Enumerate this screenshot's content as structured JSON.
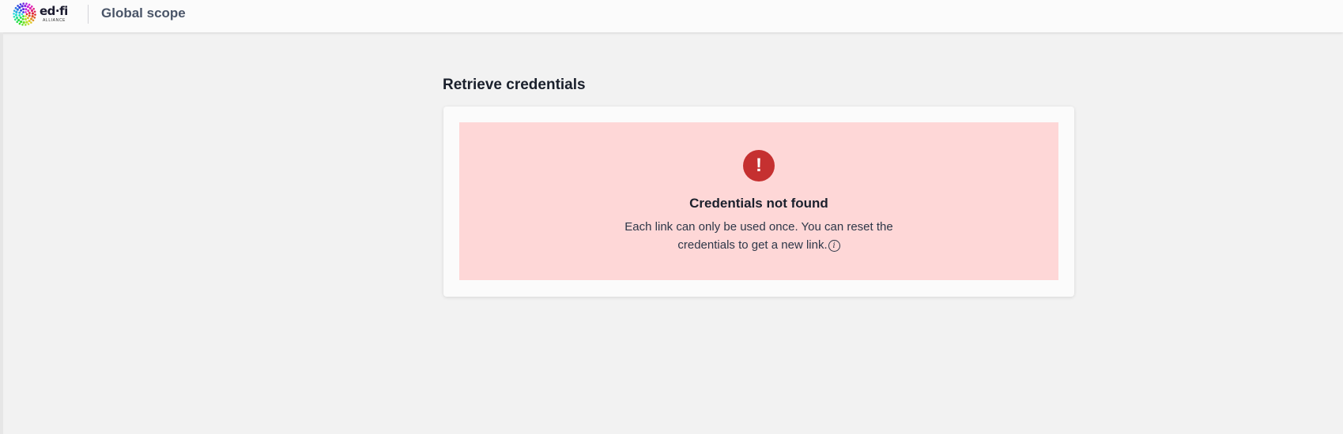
{
  "header": {
    "logo_text": "ed·fi",
    "logo_subtext": "ALLIANCE",
    "scope_title": "Global scope"
  },
  "main": {
    "heading": "Retrieve credentials",
    "alert": {
      "icon": "exclamation-icon",
      "icon_glyph": "!",
      "title": "Credentials not found",
      "message": "Each link can only be used once. You can reset the credentials to get a new link.",
      "info_icon": "info-icon",
      "info_glyph": "i"
    }
  },
  "colors": {
    "background": "#f2f2f2",
    "alert_background": "#fed7d7",
    "alert_icon": "#c53030",
    "header_background": "#fbfbfb"
  }
}
